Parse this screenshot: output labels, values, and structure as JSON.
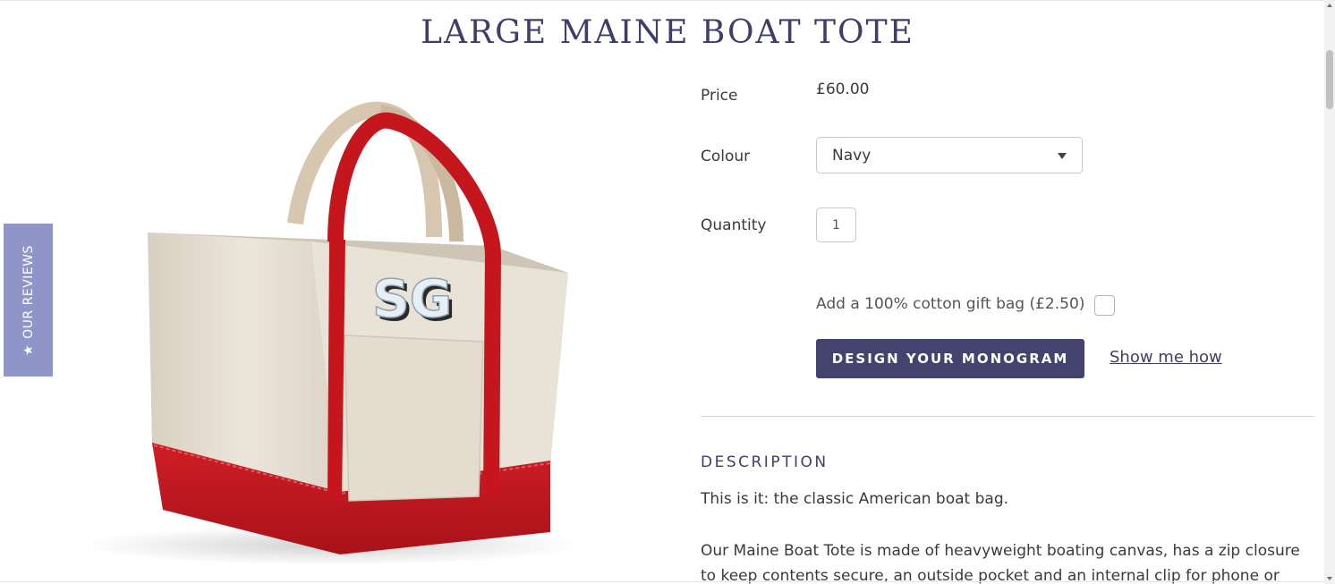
{
  "product": {
    "title": "LARGE MAINE BOAT TOTE",
    "image_monogram": "SG"
  },
  "reviews_tab": {
    "label": "OUR REVIEWS",
    "icon": "star-icon",
    "icon_glyph": "★"
  },
  "details": {
    "price_label": "Price",
    "price_value": "£60.00",
    "colour_label": "Colour",
    "colour_selected": "Navy",
    "quantity_label": "Quantity",
    "quantity_value": "1",
    "gift_bag_label": "Add a 100% cotton gift bag (£2.50)",
    "gift_bag_checked": false,
    "monogram_button": "DESIGN YOUR MONOGRAM",
    "show_me_link": "Show me how"
  },
  "description": {
    "heading": "DESCRIPTION",
    "paragraph1": "This is it: the classic American boat bag.",
    "paragraph2": "Our Maine Boat Tote is made of heavyweight boating canvas, has a zip closure to keep contents secure, an outside pocket and an internal clip for phone or"
  },
  "colors": {
    "title": "#3f3e6b",
    "button_bg": "#444370",
    "reviews_tab_bg": "#8f96c7",
    "tote_red": "#c4161c",
    "tote_canvas": "#e6ddd1"
  }
}
